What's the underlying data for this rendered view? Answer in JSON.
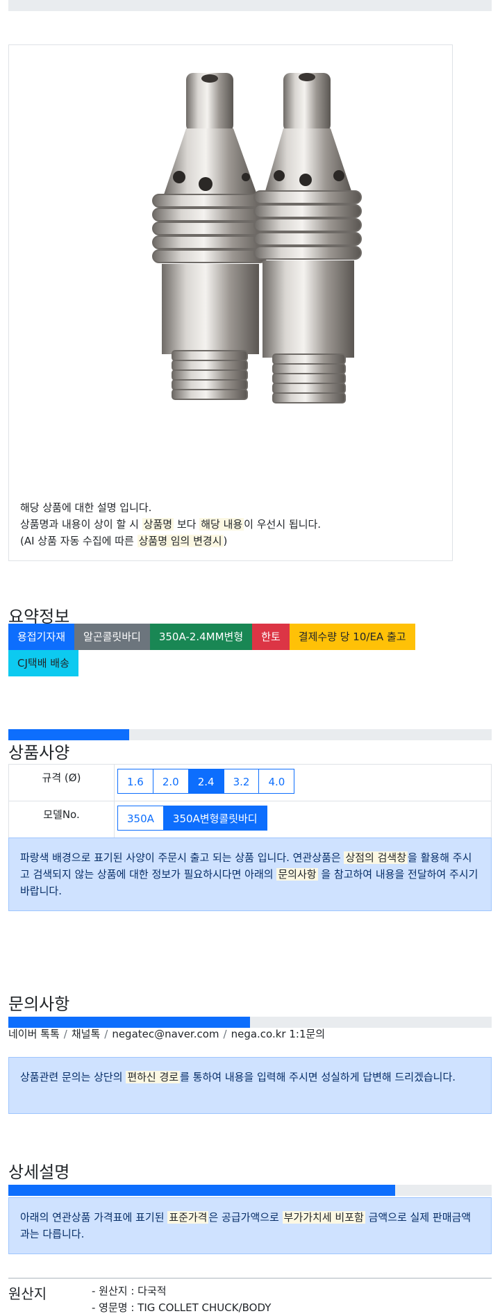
{
  "product": {
    "desc_line1": "해당 상품에 대한 설명 입니다.",
    "desc_line2_a": "상품명과 내용이 상이 할 시 ",
    "desc_line2_m1": "상품명",
    "desc_line2_b": " 보다 ",
    "desc_line2_m2": "해당 내용",
    "desc_line2_c": "이 우선시 됩니다.",
    "desc_line3_a": "(AI 상품 자동 수집에 따른 ",
    "desc_line3_m": "상품명 임의 변경시",
    "desc_line3_b": ")"
  },
  "summary": {
    "title": "요약정보",
    "badges": [
      "용접기자재",
      "알곤콜릿바디",
      "350A-2.4MM변형",
      "한토",
      "결제수량 당 10/EA 출고",
      "CJ택배 배송"
    ]
  },
  "spec": {
    "title": "상품사양",
    "rows": [
      {
        "label": "규격 (Ø)",
        "options": [
          "1.6",
          "2.0",
          "2.4",
          "3.2",
          "4.0"
        ],
        "selected": "2.4"
      },
      {
        "label": "모델No.",
        "options": [
          "350A",
          "350A변형콜릿바디"
        ],
        "selected": "350A변형콜릿바디"
      }
    ],
    "notice_a": "파랑색 배경으로 표기된 사양이 주문시 출고 되는 상품 입니다. 연관상품은 ",
    "notice_m1": "상점의 검색창",
    "notice_b": "을 활용해 주시고 검색되지 않는 상품에 대한 정보가 필요하시다면 아래의 ",
    "notice_m2": "문의사항",
    "notice_c": " 을 참고하여 내용을 전달하여 주시기 바랍니다."
  },
  "inquiry": {
    "title": "문의사항",
    "channels": [
      "네이버 톡톡",
      "채널톡",
      "negatec@naver.com",
      "nega.co.kr 1:1문의"
    ],
    "separator": "/",
    "notice_a": "상품관련 문의는 상단의 ",
    "notice_m": "편하신 경로",
    "notice_b": "를 통하여 내용을 입력해 주시면 성실하게 답변해 드리겠습니다."
  },
  "detail": {
    "title": "상세설명",
    "notice_a": "아래의 연관상품 가격표에 표기된 ",
    "notice_m1": "표준가격",
    "notice_b": "은 공급가액으로 ",
    "notice_m2": "부가가치세 비포함",
    "notice_c": " 금액으로 실제 판매금액과는 다릅니다."
  },
  "origin": {
    "label": "원산지",
    "line1": "- 원산지 : 다국적",
    "line2": "- 영문명 : TIG COLLET CHUCK/BODY"
  },
  "progress": {
    "spec": 0.25,
    "inquiry": 0.5,
    "detail": 0.8
  },
  "colors": {
    "primary": "#0d6efd",
    "alert_bg": "#cfe2ff",
    "highlight": "#fcf8e3"
  }
}
